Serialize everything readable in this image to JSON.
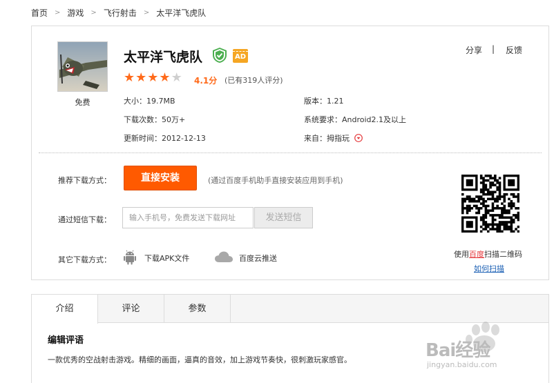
{
  "breadcrumb": {
    "items": [
      "首页",
      "游戏",
      "飞行射击",
      "太平洋飞虎队"
    ],
    "separator": ">"
  },
  "app": {
    "name": "太平洋飞虎队",
    "free_label": "免费",
    "ad_badge": "AD",
    "rating": 4.1,
    "stars_filled": 4,
    "stars_total": 5,
    "score_text": "4.1分",
    "review_text": "(已有319人评分)",
    "icon": "fighter-plane-icon"
  },
  "actions": {
    "share": "分享",
    "sep": "|",
    "feedback": "反馈"
  },
  "meta": {
    "size": "大小：19.7MB",
    "version": "版本：1.21",
    "downloads": "下载次数：50万+",
    "requirements": "系统要求：Android2.1及以上",
    "updated": "更新时间：2012-12-13",
    "source_label": "来自：",
    "source_value": "拇指玩"
  },
  "download": {
    "recommended_label": "推荐下载方式：",
    "install_button": "直接安装",
    "install_note": "(通过百度手机助手直接安装应用到手机)",
    "sms_label": "通过短信下载：",
    "phone_placeholder": "输入手机号，免费发送下载网址",
    "sms_button": "发送短信",
    "other_label": "其它下载方式：",
    "apk_link": "下载APK文件",
    "cloud_link": "百度云推送"
  },
  "qr": {
    "caption_prefix": "使用",
    "caption_brand": "百度",
    "caption_suffix": "扫描二维码",
    "howto": "如何扫描"
  },
  "tabs": [
    {
      "label": "介绍",
      "active": true
    },
    {
      "label": "评论",
      "active": false
    },
    {
      "label": "参数",
      "active": false
    }
  ],
  "intro": {
    "title": "编辑评语",
    "text": "一款优秀的空战射击游戏。精细的画面，逼真的音效，加上游戏节奏快，很刺激玩家感官。"
  },
  "watermark": {
    "brand": "Bai经验",
    "url": "jingyan.baidu.com"
  },
  "colors": {
    "accent": "#ff5a00",
    "star": "#ff6a1a",
    "link": "#1a5fb4",
    "verified": "#4caf50",
    "ad": "#f5a623"
  }
}
